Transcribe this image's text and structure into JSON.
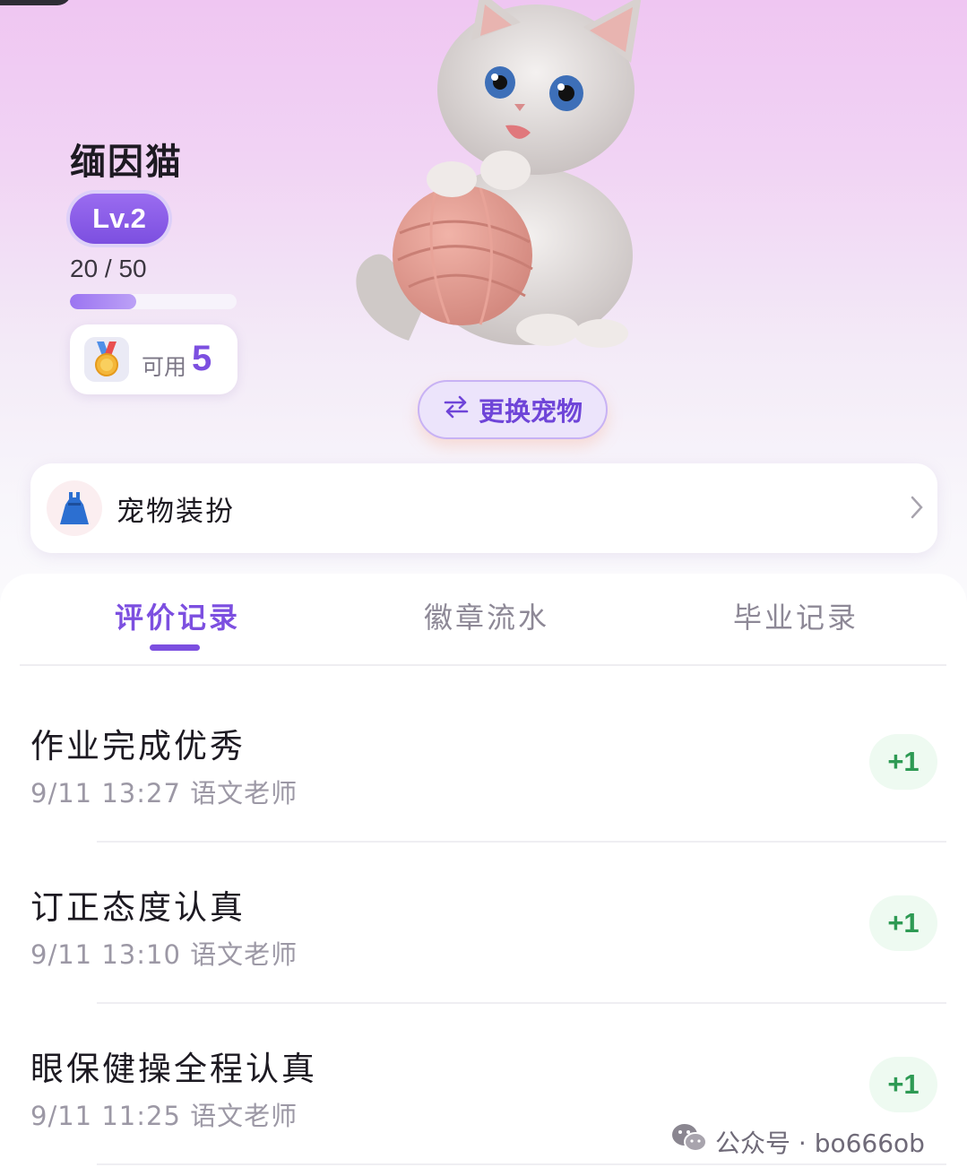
{
  "pet": {
    "name": "缅因猫",
    "level": "Lv.2",
    "xp_text": "20 / 50",
    "xp_progress": 0.4,
    "available_label": "可用",
    "available_count": "5",
    "switch_label": "更换宠物"
  },
  "dressup": {
    "label": "宠物装扮"
  },
  "tabs": [
    {
      "label": "评价记录",
      "active": true
    },
    {
      "label": "徽章流水",
      "active": false
    },
    {
      "label": "毕业记录",
      "active": false
    }
  ],
  "records": [
    {
      "title": "作业完成优秀",
      "time": "9/11 13:27 语文老师",
      "score": "+1"
    },
    {
      "title": "订正态度认真",
      "time": "9/11 13:10 语文老师",
      "score": "+1"
    },
    {
      "title": "眼保健操全程认真",
      "time": "9/11 11:25 语文老师",
      "score": "+1"
    }
  ],
  "watermark": "公众号 · bo666ob",
  "icons": [
    "swap-arrows-icon",
    "medal-icon",
    "dress-icon",
    "chevron-right-icon",
    "wechat-icon"
  ],
  "colors": {
    "accent": "#7c4fe0",
    "score": "#2e9a54"
  }
}
